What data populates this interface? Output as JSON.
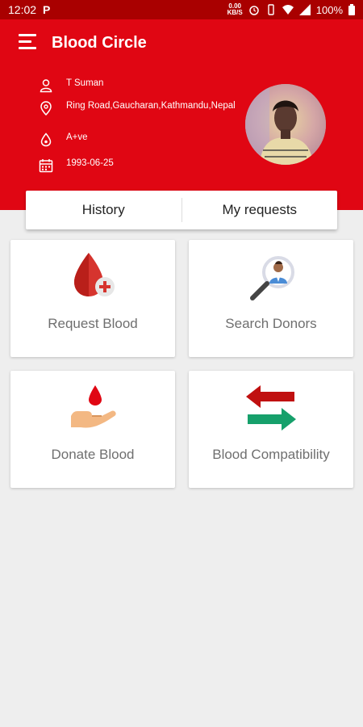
{
  "status_bar": {
    "time": "12:02",
    "notification": "P",
    "net_speed": "0.00",
    "net_unit": "KB/S",
    "battery": "100%"
  },
  "app": {
    "title": "Blood Circle"
  },
  "profile": {
    "name": "T Suman",
    "address": "Ring Road,Gaucharan,Kathmandu,Nepal",
    "blood_group": "A+ve",
    "dob": "1993-06-25"
  },
  "tabs": [
    {
      "label": "History"
    },
    {
      "label": "My requests"
    }
  ],
  "cards": [
    {
      "label": "Request Blood",
      "icon": "blood-drop-plus-icon"
    },
    {
      "label": "Search Donors",
      "icon": "search-donor-icon"
    },
    {
      "label": "Donate Blood",
      "icon": "donate-hand-icon"
    },
    {
      "label": "Blood Compatibility",
      "icon": "exchange-arrows-icon"
    }
  ],
  "colors": {
    "header": "#e00613",
    "status_bar": "#a90000",
    "background": "#eeeeee"
  }
}
